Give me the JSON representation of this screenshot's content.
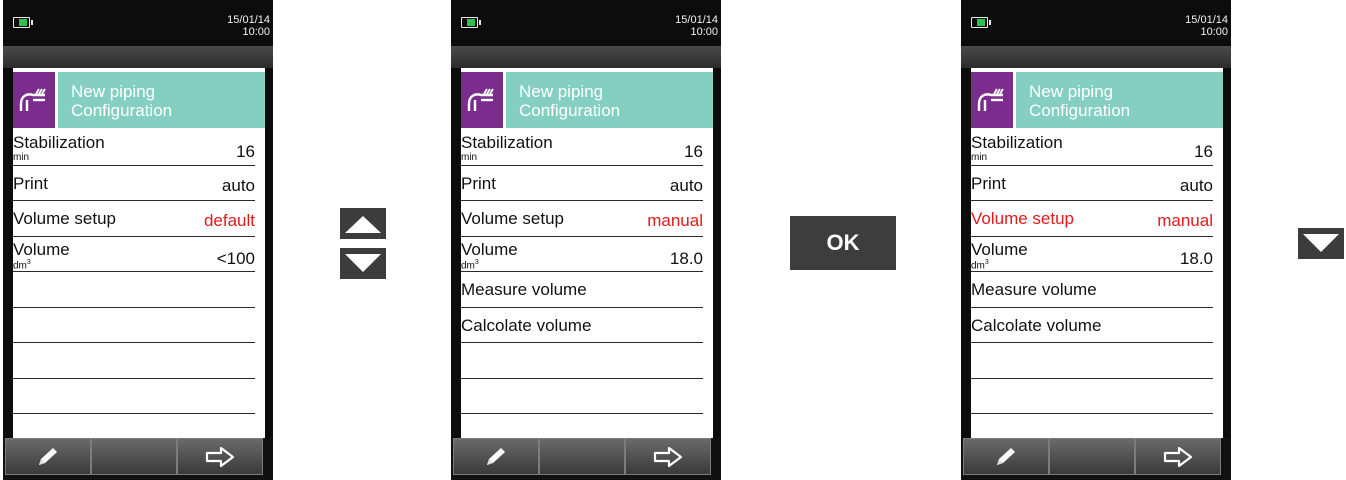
{
  "devices": [
    {
      "status": {
        "date": "15/01/14",
        "time": "10:00"
      },
      "header": {
        "title_line1": "New piping",
        "title_line2": "Configuration",
        "icon": "piping-icon"
      },
      "rows": [
        {
          "label": "Stabilization",
          "unit": "min",
          "value": "16"
        },
        {
          "label": "Print",
          "value": "auto"
        },
        {
          "label": "Volume setup",
          "value": "default",
          "value_red": true
        },
        {
          "label": "Volume",
          "unit": "dm",
          "value": "<100"
        }
      ],
      "softkeys": [
        "edit-pencil-icon",
        "",
        "next-arrow-icon"
      ]
    },
    {
      "status": {
        "date": "15/01/14",
        "time": "10:00"
      },
      "header": {
        "title_line1": "New piping",
        "title_line2": "Configuration",
        "icon": "piping-icon"
      },
      "rows": [
        {
          "label": "Stabilization",
          "unit": "min",
          "value": "16"
        },
        {
          "label": "Print",
          "value": "auto"
        },
        {
          "label": "Volume setup",
          "value": "manual",
          "value_red": true
        },
        {
          "label": "Volume",
          "unit": "dm",
          "value": "18.0"
        },
        {
          "label": "Measure volume"
        },
        {
          "label": "Calcolate volume"
        }
      ],
      "softkeys": [
        "edit-pencil-icon",
        "",
        "next-arrow-icon"
      ]
    },
    {
      "status": {
        "date": "15/01/14",
        "time": "10:00"
      },
      "header": {
        "title_line1": "New piping",
        "title_line2": "Configuration",
        "icon": "piping-icon"
      },
      "rows": [
        {
          "label": "Stabilization",
          "unit": "min",
          "value": "16"
        },
        {
          "label": "Print",
          "value": "auto"
        },
        {
          "label": "Volume setup",
          "value": "manual",
          "label_red": true,
          "value_red": true
        },
        {
          "label": "Volume",
          "unit": "dm",
          "value": "18.0"
        },
        {
          "label": "Measure volume"
        },
        {
          "label": "Calcolate volume"
        }
      ],
      "softkeys": [
        "edit-pencil-icon",
        "",
        "next-arrow-icon"
      ]
    }
  ],
  "keys": {
    "between_1_2": [
      "up-arrow-key",
      "down-arrow-key"
    ],
    "between_2_3": "OK",
    "after_3": [
      "down-arrow-key"
    ]
  },
  "colors": {
    "header_icon_bg": "#7b2d8e",
    "header_title_bg": "#84cfc1",
    "highlight_red": "#e21a1a",
    "key_bg": "#3c3c3c"
  }
}
